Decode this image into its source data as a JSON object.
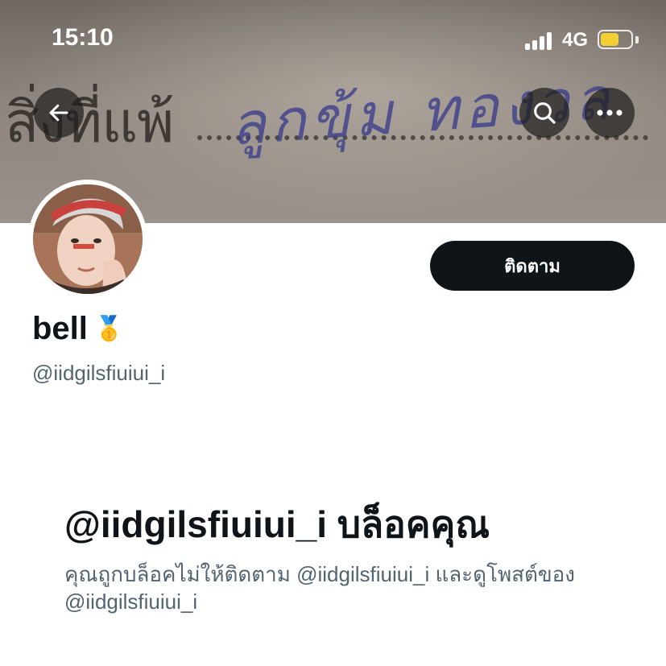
{
  "status_bar": {
    "time": "15:10",
    "network": "4G"
  },
  "header": {
    "back_icon": "arrow-left-icon",
    "search_icon": "search-icon",
    "more_icon": "more-horizontal-icon"
  },
  "banner": {
    "printed_text": "สิ่งที่แพ้",
    "handwritten_text": "ลูกขุ้ม ทองวล"
  },
  "profile": {
    "display_name": "bell",
    "badge_emoji": "🥇",
    "handle": "@iidgilsfiuiui_i",
    "follow_label": "ติดตาม"
  },
  "blocked": {
    "title": "@iidgilsfiuiui_i บล็อคคุณ",
    "description": "คุณถูกบล็อคไม่ให้ติดตาม @iidgilsfiuiui_i และดูโพสต์ของ @iidgilsfiuiui_i"
  },
  "colors": {
    "primary_text": "#0f1419",
    "secondary_text": "#536471",
    "button_bg": "#0f1419",
    "battery": "#f2cf35"
  }
}
